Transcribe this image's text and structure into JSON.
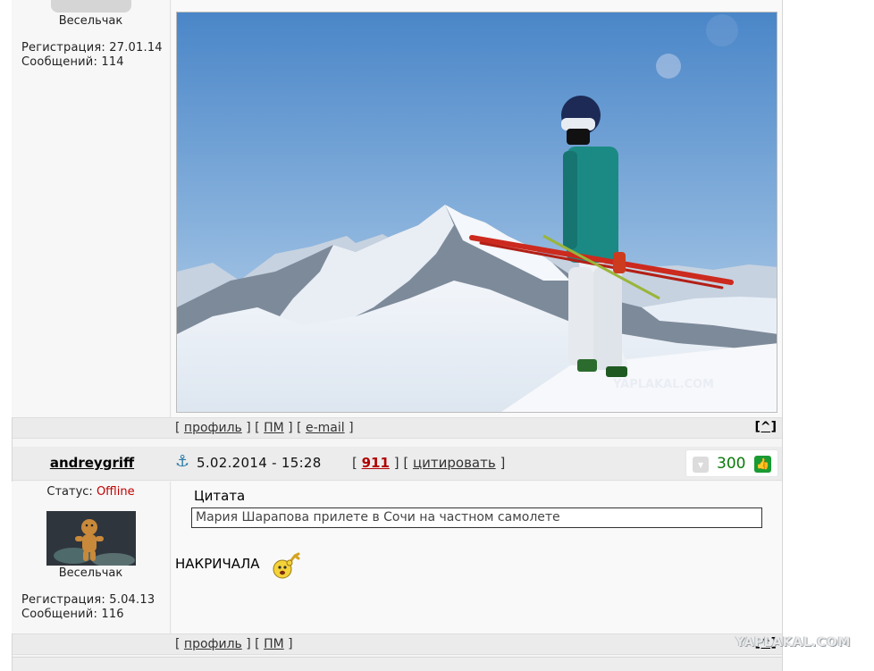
{
  "post1": {
    "rank": "Весельчак",
    "registration": "Регистрация: 27.01.14",
    "messages": "Сообщений: 114",
    "photo_watermark": "YAPLAKAL.COM",
    "bar": {
      "b1": "[ ",
      "profile": "профиль",
      "b2": " ] [ ",
      "pm": "ПМ",
      "b3": " ] [ ",
      "email": "e-mail",
      "b4": " ]",
      "top": "[^]"
    }
  },
  "post2": {
    "author": "andreygriff",
    "date": "5.02.2014 - 15:28",
    "actions": {
      "b1": "[ ",
      "number": "911",
      "b2": " ] [ ",
      "quote": "цитировать",
      "b3": " ]"
    },
    "rating": "300",
    "status_label": "Статус: ",
    "status_value": "Offline",
    "rank": "Весельчак",
    "registration": "Регистрация: 5.04.13",
    "messages": "Сообщений: 116",
    "quote_title": "Цитата",
    "quote_text": "Мария Шарапова прилете в Сочи на частном самолете",
    "text": "НАКРИЧАЛА",
    "bar": {
      "b1": "[ ",
      "profile": "профиль",
      "b2": " ] [ ",
      "pm": "ПМ",
      "b3": " ]",
      "top": "[^]"
    }
  },
  "watermark": "YAPLAKAL.COM",
  "colors": {
    "offline": "#c00000",
    "post_number": "#b00000",
    "rating": "#0a7a0a",
    "rate_up": "#1a9a33"
  },
  "icons": [
    "anchor-icon",
    "rate-down-icon",
    "thumbs-up-icon",
    "smiley-icon"
  ]
}
